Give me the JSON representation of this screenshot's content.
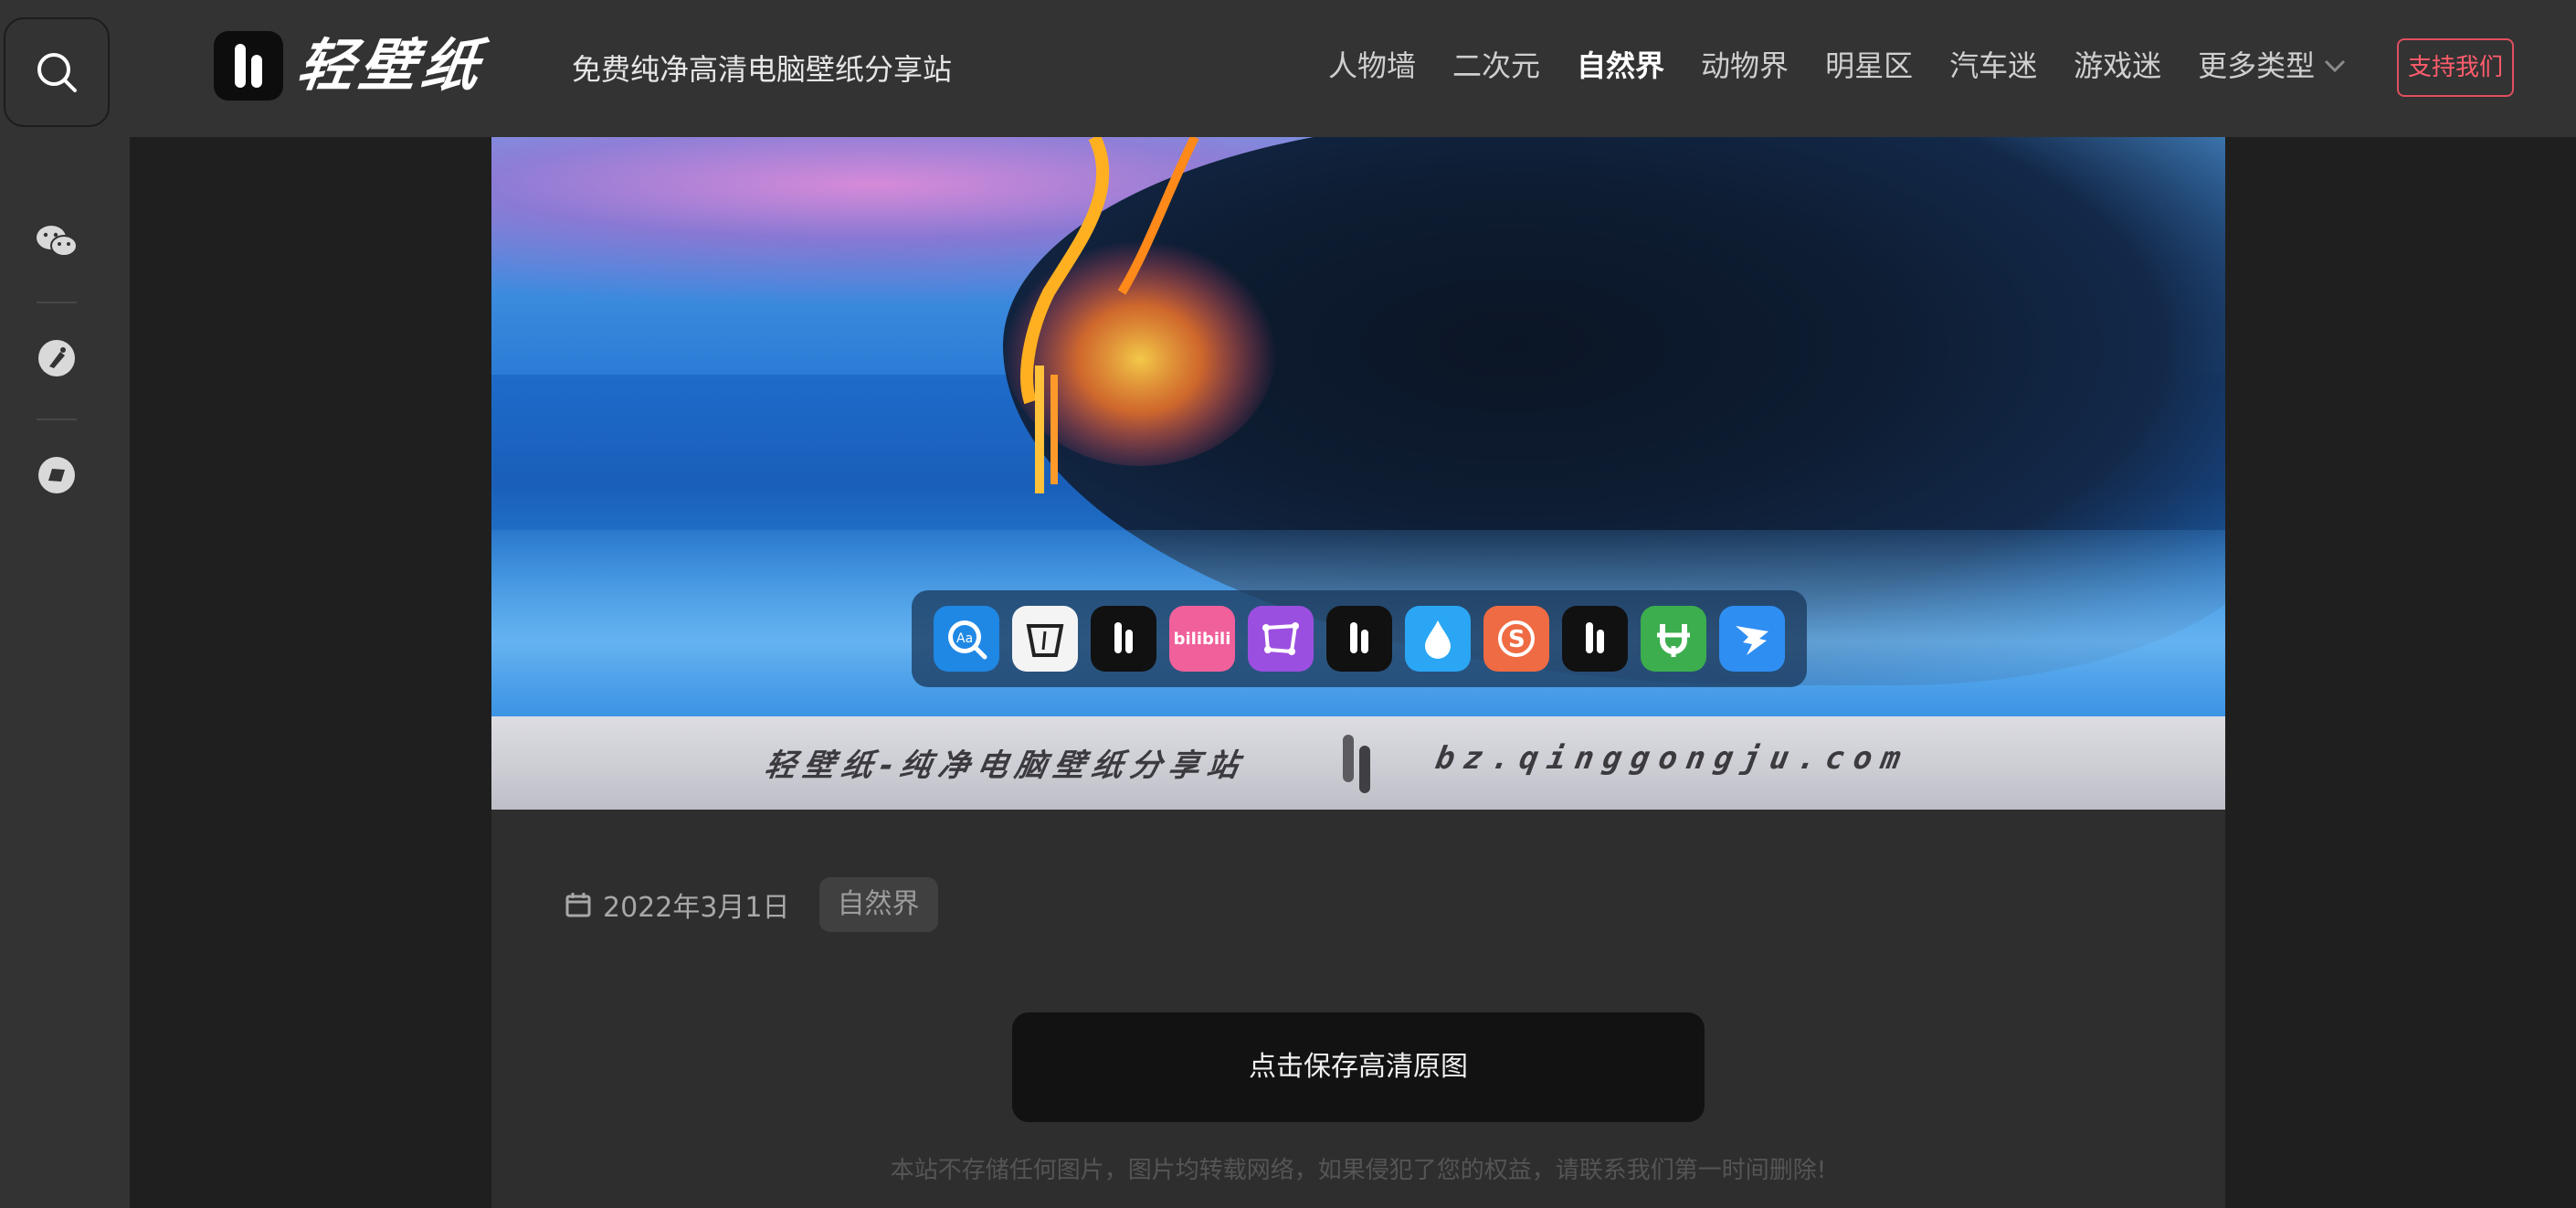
{
  "header": {
    "logo_text": "轻壁纸",
    "tagline": "免费纯净高清电脑壁纸分享站",
    "nav": [
      {
        "label": "人物墙",
        "active": false
      },
      {
        "label": "二次元",
        "active": false
      },
      {
        "label": "自然界",
        "active": true
      },
      {
        "label": "动物界",
        "active": false
      },
      {
        "label": "明星区",
        "active": false
      },
      {
        "label": "汽车迷",
        "active": false
      },
      {
        "label": "游戏迷",
        "active": false
      }
    ],
    "nav_more": "更多类型",
    "support_label": "支持我们"
  },
  "sidebar": {
    "icons": [
      "search-icon",
      "wechat-icon",
      "badminton-icon",
      "compass-icon"
    ]
  },
  "hero": {
    "dock_apps": [
      {
        "name": "reader-app-icon",
        "color": "#1f88e5",
        "glyph": "Aa"
      },
      {
        "name": "cup-app-icon",
        "color": "#f4f4f4",
        "glyph": ""
      },
      {
        "name": "qingbizhi-app-icon",
        "color": "#111111",
        "glyph": ""
      },
      {
        "name": "bilibili-app-icon",
        "color": "#f0609a",
        "glyph": "bilibili"
      },
      {
        "name": "crop-app-icon",
        "color": "#9b4fe0",
        "glyph": ""
      },
      {
        "name": "qingbizhi-app-icon-2",
        "color": "#111111",
        "glyph": ""
      },
      {
        "name": "drop-app-icon",
        "color": "#2aa6f4",
        "glyph": ""
      },
      {
        "name": "s-app-icon",
        "color": "#ef6b43",
        "glyph": "S"
      },
      {
        "name": "qingbizhi-app-icon-3",
        "color": "#111111",
        "glyph": ""
      },
      {
        "name": "green-app-icon",
        "color": "#3cae4e",
        "glyph": ""
      },
      {
        "name": "dingtalk-app-icon",
        "color": "#2f8ef2",
        "glyph": ""
      }
    ],
    "banner_left": "轻壁纸-纯净电脑壁纸分享站",
    "banner_right": "bz.qinggongju.com"
  },
  "post": {
    "date": "2022年3月1日",
    "category": "自然界",
    "save_label": "点击保存高清原图",
    "disclaimer": "本站不存储任何图片，图片均转载网络，如果侵犯了您的权益，请联系我们第一时间删除!"
  }
}
